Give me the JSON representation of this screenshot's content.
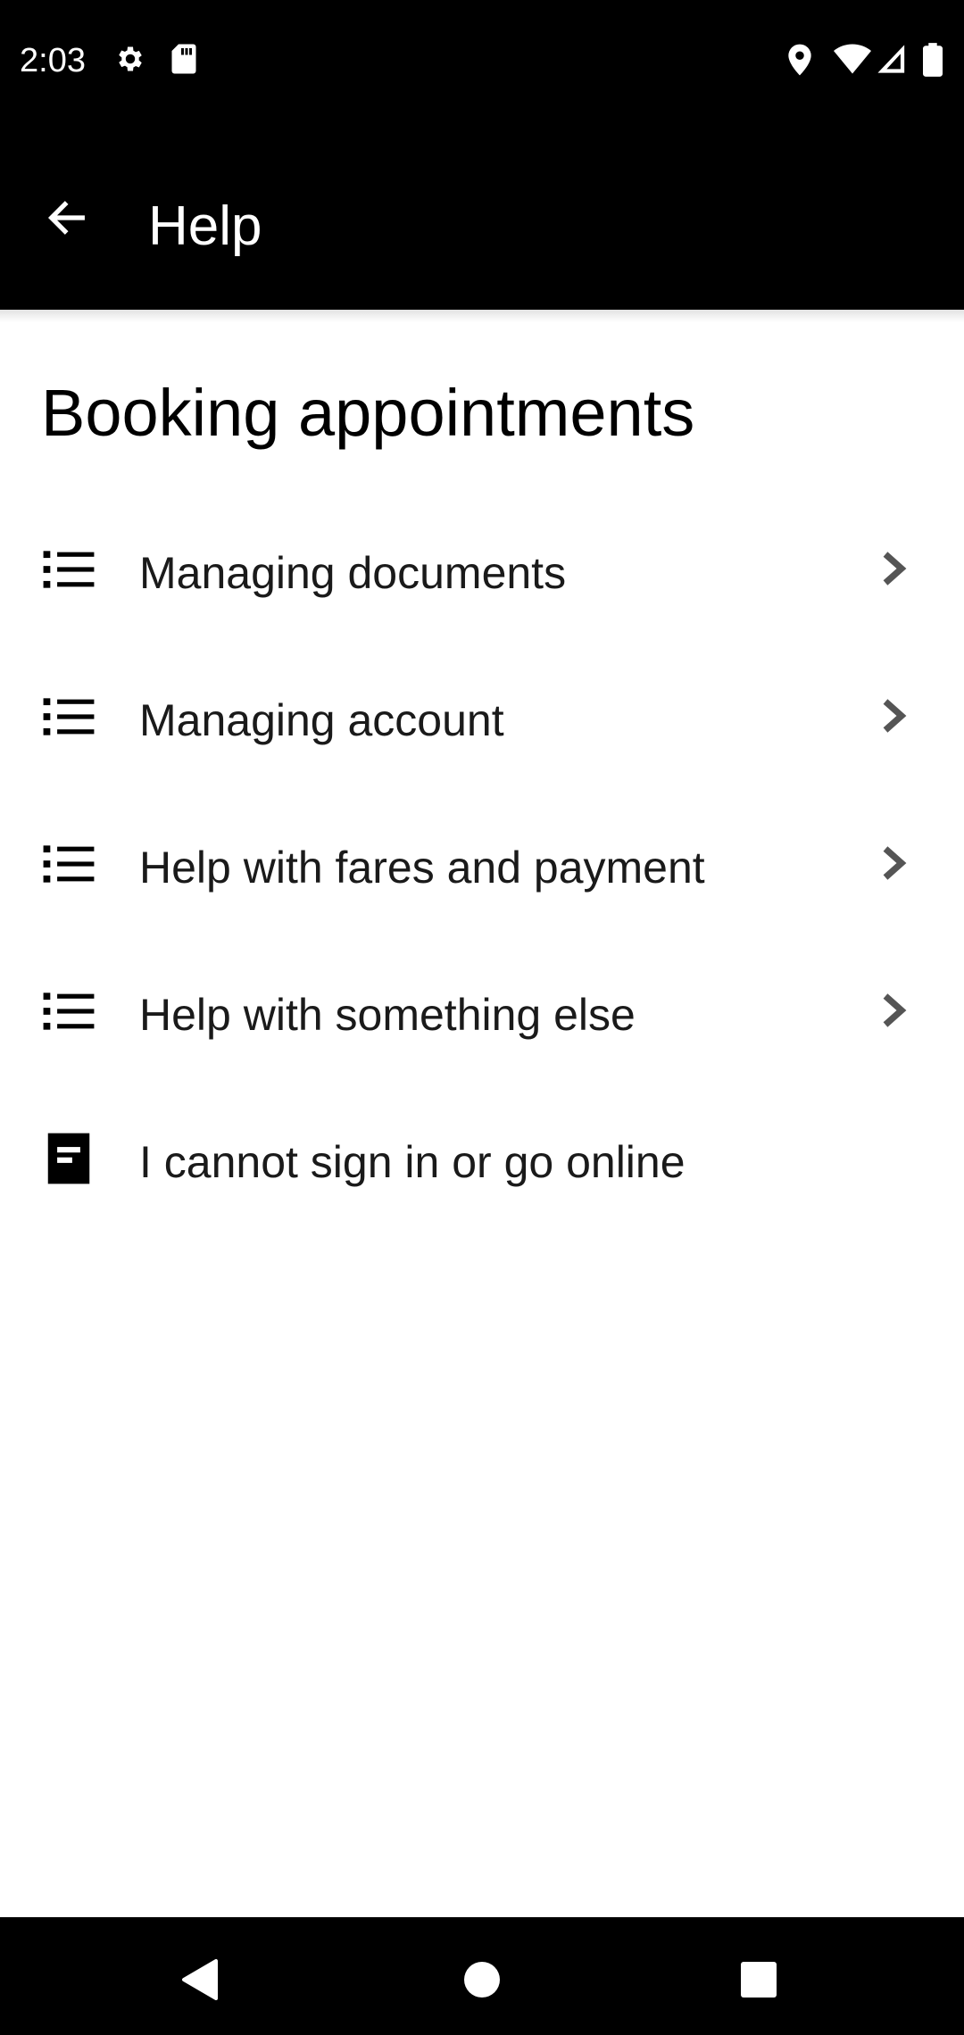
{
  "status_bar": {
    "time": "2:03",
    "left_icons": [
      "gear-icon",
      "sd-card-icon"
    ],
    "right_icons": [
      "location-icon",
      "wifi-icon",
      "signal-icon",
      "battery-icon"
    ]
  },
  "app_bar": {
    "title": "Help",
    "back_icon": "arrow-left-icon"
  },
  "section": {
    "title": "Booking appointments"
  },
  "items": [
    {
      "label": "Managing documents",
      "icon": "list-icon",
      "has_chevron": true
    },
    {
      "label": "Managing account",
      "icon": "list-icon",
      "has_chevron": true
    },
    {
      "label": "Help with fares and payment",
      "icon": "list-icon",
      "has_chevron": true
    },
    {
      "label": "Help with something else",
      "icon": "list-icon",
      "has_chevron": true
    },
    {
      "label": "I cannot sign in or go online",
      "icon": "article-icon",
      "has_chevron": false
    }
  ],
  "nav_bar": {
    "buttons": [
      "back-triangle-icon",
      "home-circle-icon",
      "recents-square-icon"
    ]
  },
  "colors": {
    "bars": "#000000",
    "background": "#ffffff",
    "text": "#000000",
    "chevron": "#555555"
  }
}
